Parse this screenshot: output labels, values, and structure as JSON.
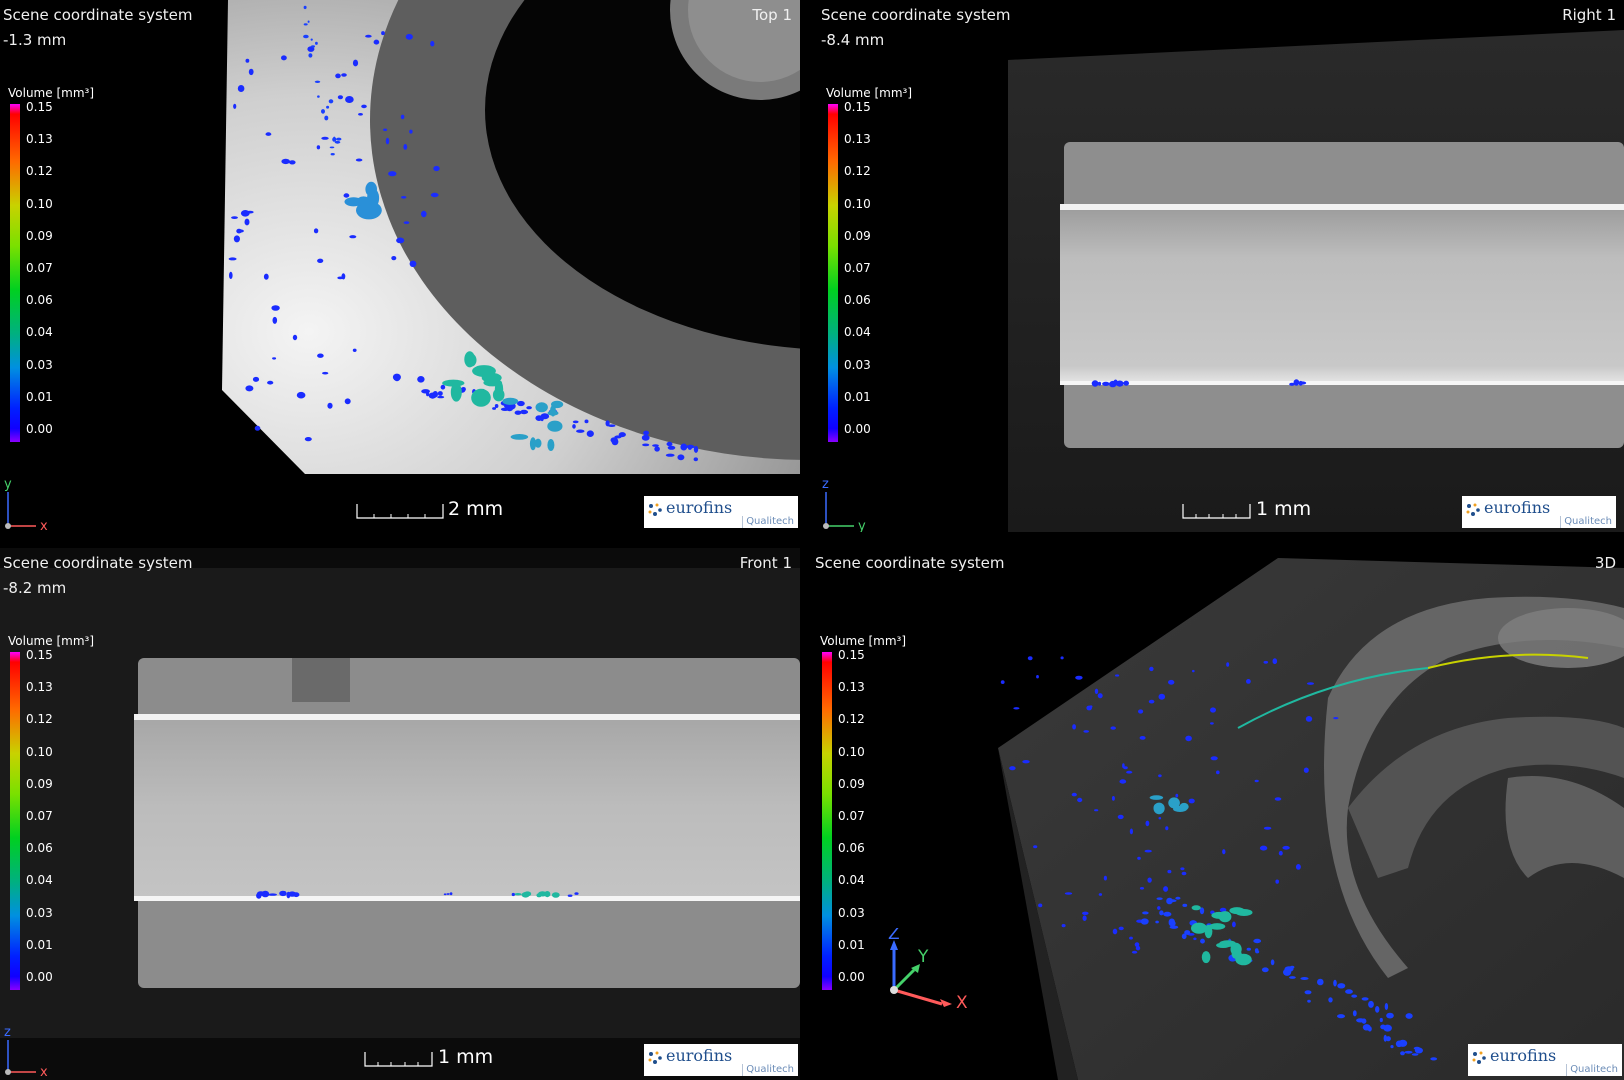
{
  "legend": {
    "title": "Volume [mm³]",
    "ticks": [
      "0.15",
      "0.13",
      "0.12",
      "0.10",
      "0.09",
      "0.07",
      "0.06",
      "0.04",
      "0.03",
      "0.01",
      "0.00"
    ]
  },
  "logo": {
    "word": "eurofins",
    "sub": "Qualitech"
  },
  "viewports": {
    "top": {
      "system": "Scene coordinate system",
      "depth": "-1.3 mm",
      "title": "Top 1",
      "scale": "2 mm",
      "axis_v": "y",
      "axis_h": "x"
    },
    "right": {
      "system": "Scene coordinate system",
      "depth": "-8.4 mm",
      "title": "Right 1",
      "scale": "1 mm",
      "axis_v": "z",
      "axis_h": "y"
    },
    "front": {
      "system": "Scene coordinate system",
      "depth": "-8.2 mm",
      "title": "Front 1",
      "scale": "1 mm",
      "axis_v": "z",
      "axis_h": "x"
    },
    "3d": {
      "system": "Scene coordinate system",
      "title": "3D",
      "axis_z": "Z",
      "axis_y": "Y",
      "axis_x": "X"
    }
  },
  "colors": {
    "legend_max": "#ff00ff",
    "legend_min": "#8a00ff",
    "pore_low": "#1a2cff",
    "pore_mid": "#20b8a0",
    "logo_text": "#1f4e8c"
  }
}
